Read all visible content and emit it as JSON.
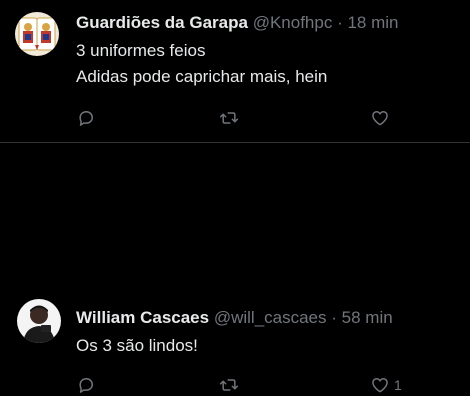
{
  "colors": {
    "background": "#000000",
    "text_primary": "#e7e9ea",
    "text_secondary": "#71767b",
    "divider": "#2f3336"
  },
  "tweets": [
    {
      "display_name": "Guardiões da Garapa",
      "handle": "@Knofhpc",
      "separator": "·",
      "time": "18 min",
      "lines": [
        "3 uniformes feios",
        "Adidas pode caprichar mais, hein"
      ],
      "avatar_icon": "playing-card-avatar",
      "actions": {
        "reply_icon": "reply-icon",
        "retweet_icon": "retweet-icon",
        "like_icon": "heart-icon",
        "like_count": ""
      }
    },
    {
      "display_name": "William Cascaes",
      "handle": "@will_cascaes",
      "separator": "·",
      "time": "58 min",
      "lines": [
        "Os 3 são lindos!"
      ],
      "avatar_icon": "user-photo-avatar",
      "actions": {
        "reply_icon": "reply-icon",
        "retweet_icon": "retweet-icon",
        "like_icon": "heart-icon",
        "like_count": "1"
      }
    }
  ]
}
